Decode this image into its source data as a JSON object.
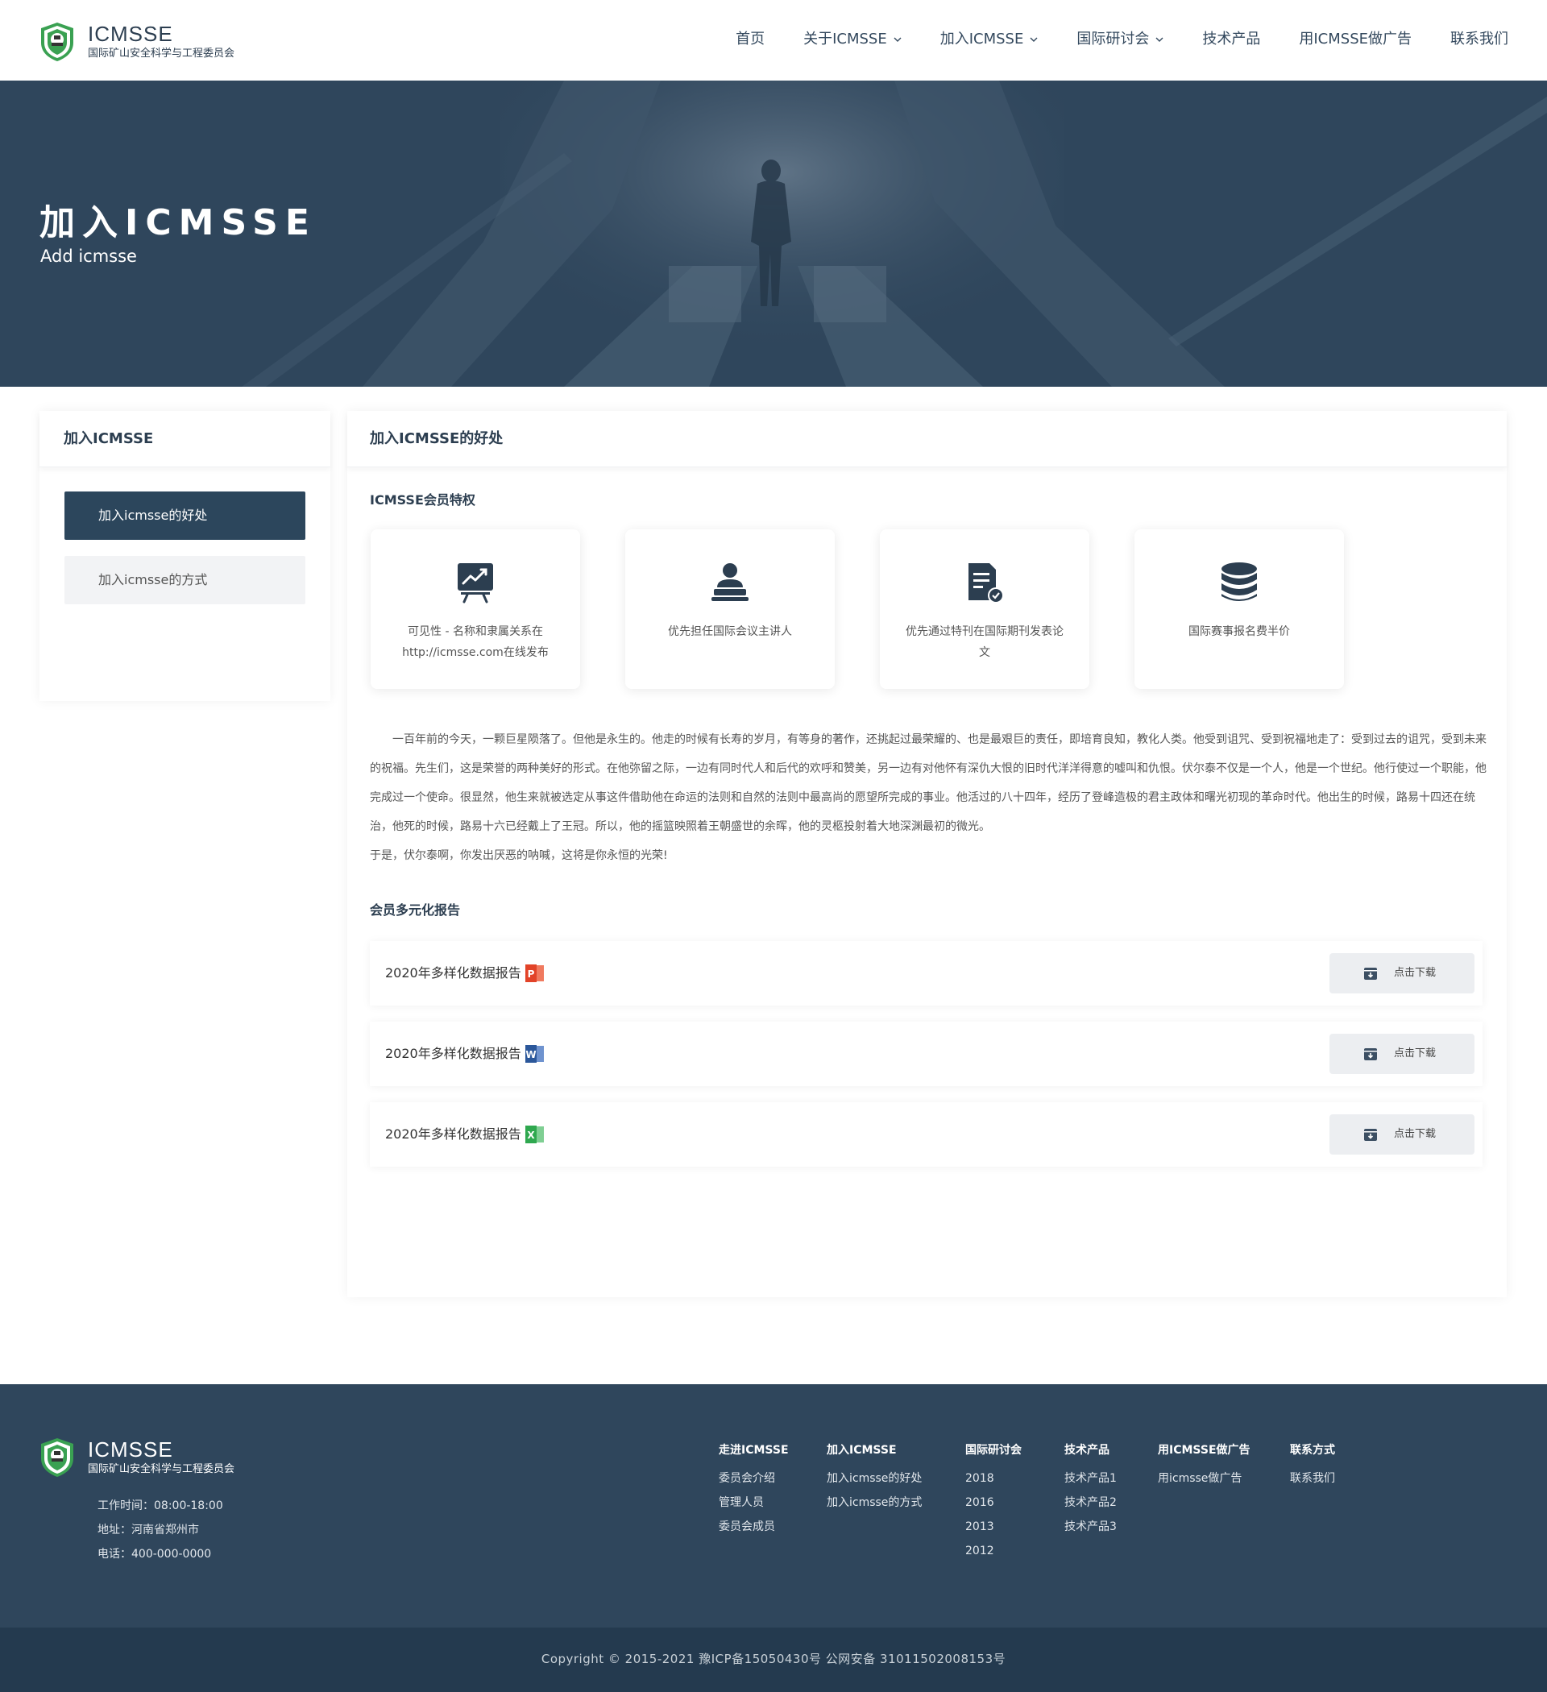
{
  "header": {
    "logo_title": "ICMSSE",
    "logo_sub": "国际矿山安全科学与工程委员会",
    "nav": [
      {
        "label": "首页",
        "dropdown": false
      },
      {
        "label": "关于ICMSSE",
        "dropdown": true
      },
      {
        "label": "加入ICMSSE",
        "dropdown": true
      },
      {
        "label": "国际研讨会",
        "dropdown": true
      },
      {
        "label": "技术产品",
        "dropdown": false
      },
      {
        "label": "用ICMSSE做广告",
        "dropdown": false
      },
      {
        "label": "联系我们",
        "dropdown": false
      }
    ]
  },
  "banner": {
    "title": "加入ICMSSE",
    "subtitle": "Add icmsse"
  },
  "sidebar": {
    "title": "加入ICMSSE",
    "items": [
      {
        "label": "加入icmsse的好处",
        "active": true
      },
      {
        "label": "加入icmsse的方式",
        "active": false
      }
    ]
  },
  "main": {
    "title": "加入ICMSSE的好处",
    "features_title": "ICMSSE会员特权",
    "features": [
      {
        "icon": "presentation-chart-icon",
        "text": "可见性 - 名称和隶属关系在http://icmsse.com在线发布"
      },
      {
        "icon": "speaker-icon",
        "text": "优先担任国际会议主讲人"
      },
      {
        "icon": "document-check-icon",
        "text": "优先通过特刊在国际期刊发表论文"
      },
      {
        "icon": "database-icon",
        "text": "国际赛事报名费半价"
      }
    ],
    "paragraph1": "一百年前的今天，一颗巨星陨落了。但他是永生的。他走的时候有长寿的岁月，有等身的著作，还挑起过最荣耀的、也是最艰巨的责任，即培育良知，教化人类。他受到诅咒、受到祝福地走了：受到过去的诅咒，受到未来的祝福。先生们，这是荣誉的两种美好的形式。在他弥留之际，一边有同时代人和后代的欢呼和赞美，另一边有对他怀有深仇大恨的旧时代洋洋得意的嘘叫和仇恨。伏尔泰不仅是一个人，他是一个世纪。他行使过一个职能，他完成过一个使命。很显然，他生来就被选定从事这件借助他在命运的法则和自然的法则中最高尚的愿望所完成的事业。他活过的八十四年，经历了登峰造极的君主政体和曙光初现的革命时代。他出生的时候，路易十四还在统治，他死的时候，路易十六已经戴上了王冠。所以，他的摇篮映照着王朝盛世的余晖，他的灵柩投射着大地深渊最初的微光。",
    "paragraph2": "于是，伏尔泰啊，你发出厌恶的呐喊，这将是你永恒的光荣!",
    "reports_title": "会员多元化报告",
    "reports": [
      {
        "title": "2020年多样化数据报告",
        "file_type": "ppt-file-icon",
        "file_letter": "P",
        "color": "#e24328",
        "button": "点击下载"
      },
      {
        "title": "2020年多样化数据报告",
        "file_type": "word-file-icon",
        "file_letter": "W",
        "color": "#2b579a",
        "button": "点击下载"
      },
      {
        "title": "2020年多样化数据报告",
        "file_type": "excel-file-icon",
        "file_letter": "X",
        "color": "#2fa84f",
        "button": "点击下载"
      }
    ]
  },
  "footer": {
    "logo_title": "ICMSSE",
    "logo_sub": "国际矿山安全科学与工程委员会",
    "hours": "工作时间：08:00-18:00",
    "address": "地址：河南省郑州市",
    "phone": "电话：400-000-0000",
    "columns": [
      {
        "title": "走进ICMSSE",
        "links": [
          "委员会介绍",
          "管理人员",
          "委员会成员"
        ]
      },
      {
        "title": "加入ICMSSE",
        "links": [
          "加入icmsse的好处",
          "加入icmsse的方式"
        ]
      },
      {
        "title": "国际研讨会",
        "links": [
          "2018",
          "2016",
          "2013",
          "2012"
        ]
      },
      {
        "title": "技术产品",
        "links": [
          "技术产品1",
          "技术产品2",
          "技术产品3"
        ]
      },
      {
        "title": "用ICMSSE做广告",
        "links": [
          "用icmsse做广告"
        ]
      },
      {
        "title": "联系方式",
        "links": [
          "联系我们"
        ]
      }
    ],
    "copyright": "Copyright © 2015-2021  豫ICP备15050430号  公网安备 31011502008153号"
  },
  "colors": {
    "primary": "#2c465c",
    "banner": "#2f465c",
    "footer": "#2f465c",
    "copyright_bar": "#243a4f",
    "logo_green": "#3aa152"
  }
}
